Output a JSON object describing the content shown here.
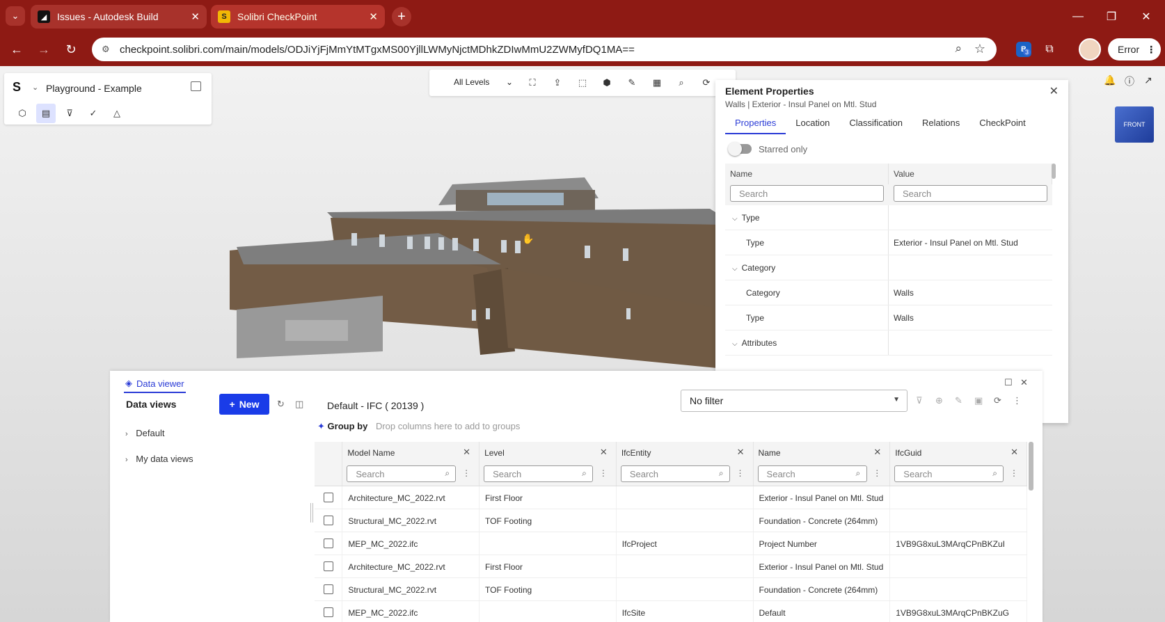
{
  "browser": {
    "tabs": [
      {
        "title": "Issues - Autodesk Build",
        "favicon": "autodesk-icon"
      },
      {
        "title": "Solibri CheckPoint",
        "favicon": "solibri-icon"
      }
    ],
    "url": "checkpoint.solibri.com/main/models/ODJiYjFjMmYtMTgxMS00YjllLWMyNjctMDhkZDIwMmU2ZWMyfDQ1MA==",
    "extension_badge": "3",
    "error_label": "Error",
    "accent_color": "#8e1a14"
  },
  "project": {
    "logo": "S",
    "name": "Playground - Example"
  },
  "toolbar": {
    "level_select": "All Levels"
  },
  "navcube": {
    "face": "FRONT"
  },
  "element_properties": {
    "title": "Element Properties",
    "subtitle": "Walls | Exterior - Insul Panel on Mtl. Stud",
    "tabs": [
      "Properties",
      "Location",
      "Classification",
      "Relations",
      "CheckPoint"
    ],
    "active_tab": "Properties",
    "starred_label": "Starred only",
    "columns": {
      "name": "Name",
      "value": "Value"
    },
    "search_placeholder": "Search",
    "groups": [
      {
        "name": "Type",
        "rows": [
          {
            "name": "Type",
            "value": "Exterior - Insul Panel on Mtl. Stud"
          }
        ]
      },
      {
        "name": "Category",
        "rows": [
          {
            "name": "Category",
            "value": "Walls"
          },
          {
            "name": "Type",
            "value": "Walls"
          }
        ]
      },
      {
        "name": "Attributes",
        "rows": []
      }
    ]
  },
  "data_viewer": {
    "tab_label": "Data viewer",
    "left_title": "Data views",
    "new_button": "New",
    "tree": [
      "Default",
      "My data views"
    ],
    "view_title": "Default - IFC ( 20139 )",
    "filter_value": "No filter",
    "group_by_label": "Group by",
    "group_by_hint": "Drop columns here to add to groups",
    "search_placeholder": "Search",
    "columns": [
      "Model Name",
      "Level",
      "IfcEntity",
      "Name",
      "IfcGuid"
    ],
    "rows": [
      [
        "Architecture_MC_2022.rvt",
        "First Floor",
        "",
        "Exterior - Insul Panel on Mtl. Stud",
        ""
      ],
      [
        "Structural_MC_2022.rvt",
        "TOF Footing",
        "",
        "Foundation - Concrete (264mm)",
        ""
      ],
      [
        "MEP_MC_2022.ifc",
        "",
        "IfcProject",
        "Project Number",
        "1VB9G8xuL3MArqCPnBKZuI"
      ],
      [
        "Architecture_MC_2022.rvt",
        "First Floor",
        "",
        "Exterior - Insul Panel on Mtl. Stud",
        ""
      ],
      [
        "Structural_MC_2022.rvt",
        "TOF Footing",
        "",
        "Foundation - Concrete (264mm)",
        ""
      ],
      [
        "MEP_MC_2022.ifc",
        "",
        "IfcSite",
        "Default",
        "1VB9G8xuL3MArqCPnBKZuG"
      ]
    ]
  }
}
